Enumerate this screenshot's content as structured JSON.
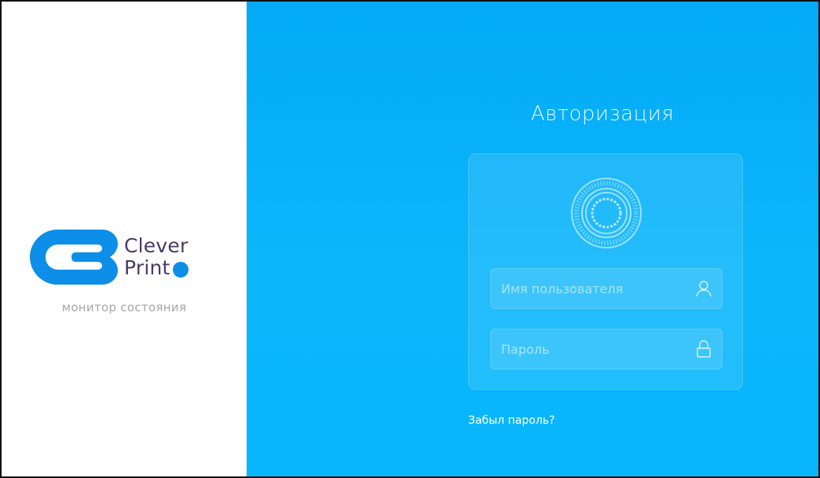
{
  "brand": {
    "name_line1": "Clever",
    "name_line2": "Print",
    "subtitle": "монитор состояния",
    "colors": {
      "accent": "#0d8ee8",
      "text": "#4a3a66"
    }
  },
  "auth": {
    "title": "Авторизация",
    "username": {
      "value": "",
      "placeholder": "Имя пользователя",
      "icon": "user-icon"
    },
    "password": {
      "value": "",
      "placeholder": "Пароль",
      "icon": "lock-icon"
    },
    "forgot_link": "Забыл пароль?",
    "emblem_icon": "fingerprint-icon",
    "colors": {
      "background": "#0bb6fb"
    }
  }
}
